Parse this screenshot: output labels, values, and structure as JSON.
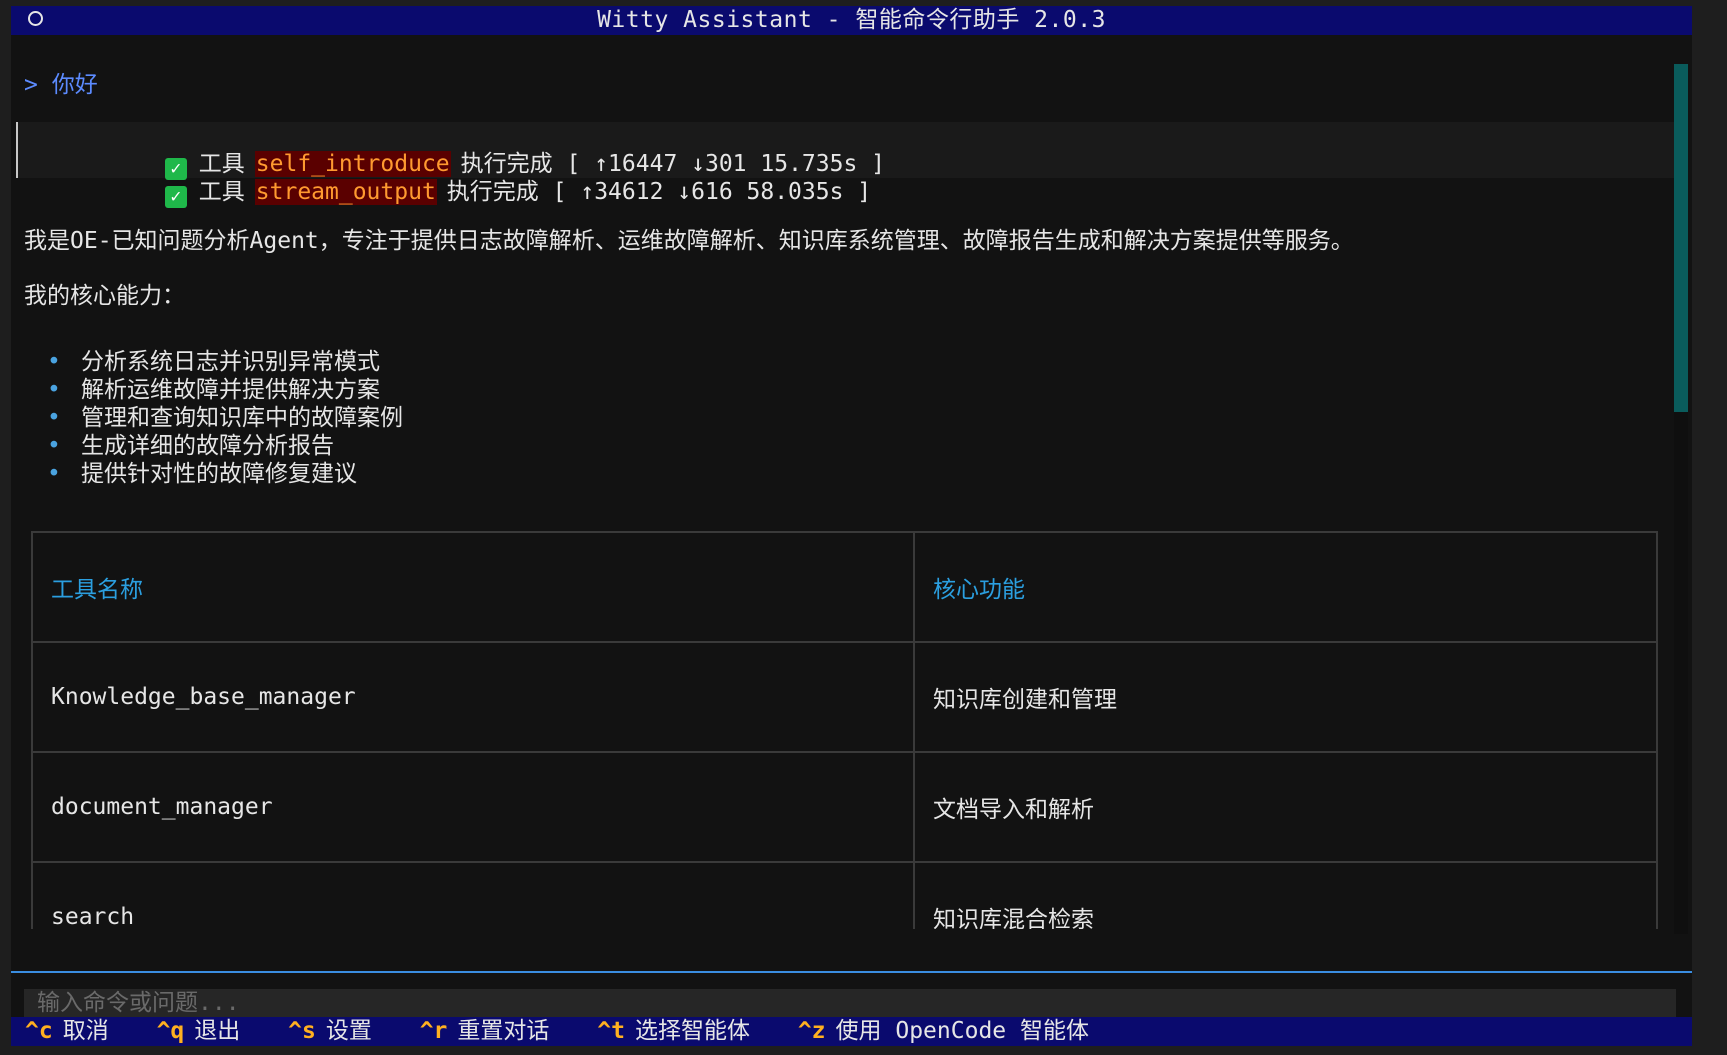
{
  "window": {
    "title": "Witty Assistant - 智能命令行助手 2.0.3"
  },
  "conversation": {
    "user_prompt": "> 你好",
    "tools": [
      {
        "label": "工具",
        "name": "self_introduce",
        "status": "执行完成",
        "stats": "[ ↑16447 ↓301 15.735s ]"
      },
      {
        "label": "工具",
        "name": "stream_output",
        "status": "执行完成",
        "stats": "[ ↑34612 ↓616 58.035s ]"
      }
    ],
    "intro": "我是OE-已知问题分析Agent，专注于提供日志故障解析、运维故障解析、知识库系统管理、故障报告生成和解决方案提供等服务。",
    "abilities_title": "我的核心能力：",
    "abilities": [
      "分析系统日志并识别异常模式",
      "解析运维故障并提供解决方案",
      "管理和查询知识库中的故障案例",
      "生成详细的故障分析报告",
      "提供针对性的故障修复建议"
    ],
    "bullet_char": "•",
    "table": {
      "headers": [
        "工具名称",
        "核心功能"
      ],
      "rows": [
        [
          "Knowledge_base_manager",
          "知识库创建和管理"
        ],
        [
          "document_manager",
          "文档导入和解析"
        ],
        [
          "search",
          "知识库混合检索"
        ]
      ]
    }
  },
  "input": {
    "placeholder": "输入命令或问题..."
  },
  "footer": {
    "shortcuts": [
      {
        "key": "^c",
        "label": "取消"
      },
      {
        "key": "^q",
        "label": "退出"
      },
      {
        "key": "^s",
        "label": "设置"
      },
      {
        "key": "^r",
        "label": "重置对话"
      },
      {
        "key": "^t",
        "label": "选择智能体"
      },
      {
        "key": "^z",
        "label": "使用 OpenCode 智能体"
      }
    ]
  },
  "colors": {
    "titlebar_bg": "#0a0a6e",
    "user_prompt": "#5c8bff",
    "check_green": "#1fb84a",
    "tool_name_fg": "#ff9a30",
    "tool_name_bg": "#5a0000",
    "table_header": "#2b9fe0",
    "shortcut_key": "#ffb020",
    "scrollbar_thumb": "#0a5c5c"
  },
  "icons": {
    "title": "circle-icon",
    "tool_status": "checkmark-icon"
  }
}
